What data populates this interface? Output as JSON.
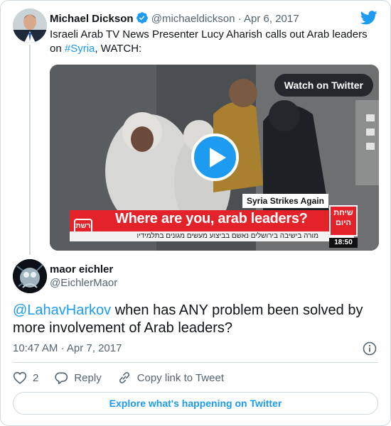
{
  "quoted_tweet": {
    "author_name": "Michael Dickson",
    "author_handle": "@michaeldickson",
    "separator": "·",
    "date": "Apr 6, 2017",
    "text_before": "Israeli Arab TV News Presenter Lucy Aharish calls out Arab leaders on ",
    "hashtag": "#Syria",
    "text_after": ", WATCH:",
    "video": {
      "watch_label": "Watch on Twitter",
      "kicker": "Syria Strikes Again",
      "headline": "Where are you, arab leaders?",
      "ticker": "מורה בישיבה בירושלים נאשם בביצוע מעשים מגונים בתלמידיו",
      "network_logo": "רשת",
      "show_name": "שיחת היום",
      "clock": "18:50"
    }
  },
  "tweet": {
    "author_name": "maor eichler",
    "author_handle": "@EichlerMaor",
    "mention": "@LahavHarkov",
    "text": " when has ANY problem been solved by more involvement of Arab leaders?",
    "timestamp": "10:47 AM · Apr 7, 2017"
  },
  "actions": {
    "like_count": "2",
    "reply_label": "Reply",
    "copy_label": "Copy link to Tweet"
  },
  "footer": {
    "explore_label": "Explore what's happening on Twitter"
  },
  "colors": {
    "accent": "#1d9bf0",
    "text": "#0f1419",
    "muted": "#536471",
    "border": "#cfd9de",
    "broadcast_red": "#e32229"
  }
}
